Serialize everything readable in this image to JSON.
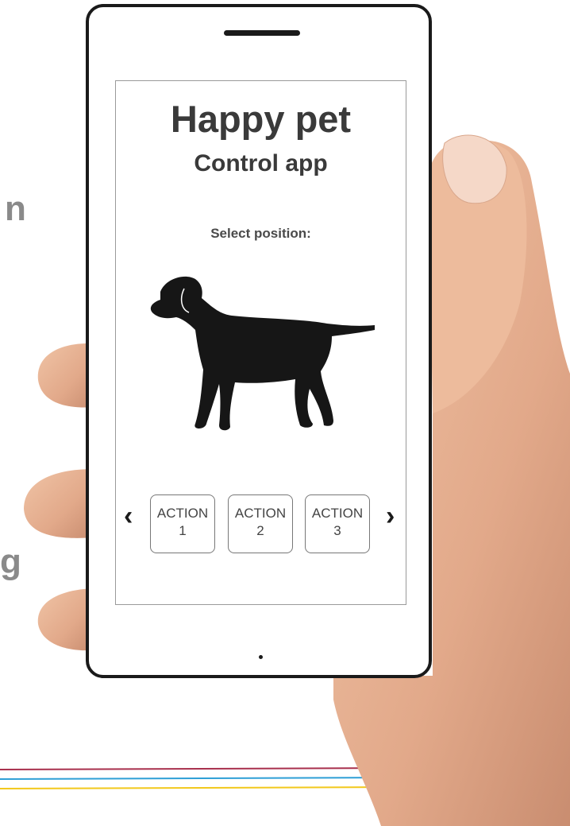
{
  "background": {
    "partial_text_1": "n",
    "partial_text_2": "g",
    "stripe_colors": [
      "#a8304d",
      "#2e9fd6",
      "#f2c81c"
    ]
  },
  "app": {
    "title": "Happy pet",
    "subtitle": "Control app",
    "prompt": "Select position:",
    "illustration": "dog-silhouette",
    "prev_icon": "chevron-left-icon",
    "next_icon": "chevron-right-icon",
    "actions": [
      {
        "line1": "ACTION",
        "line2": "1"
      },
      {
        "line1": "ACTION",
        "line2": "2"
      },
      {
        "line1": "ACTION",
        "line2": "3"
      }
    ]
  }
}
